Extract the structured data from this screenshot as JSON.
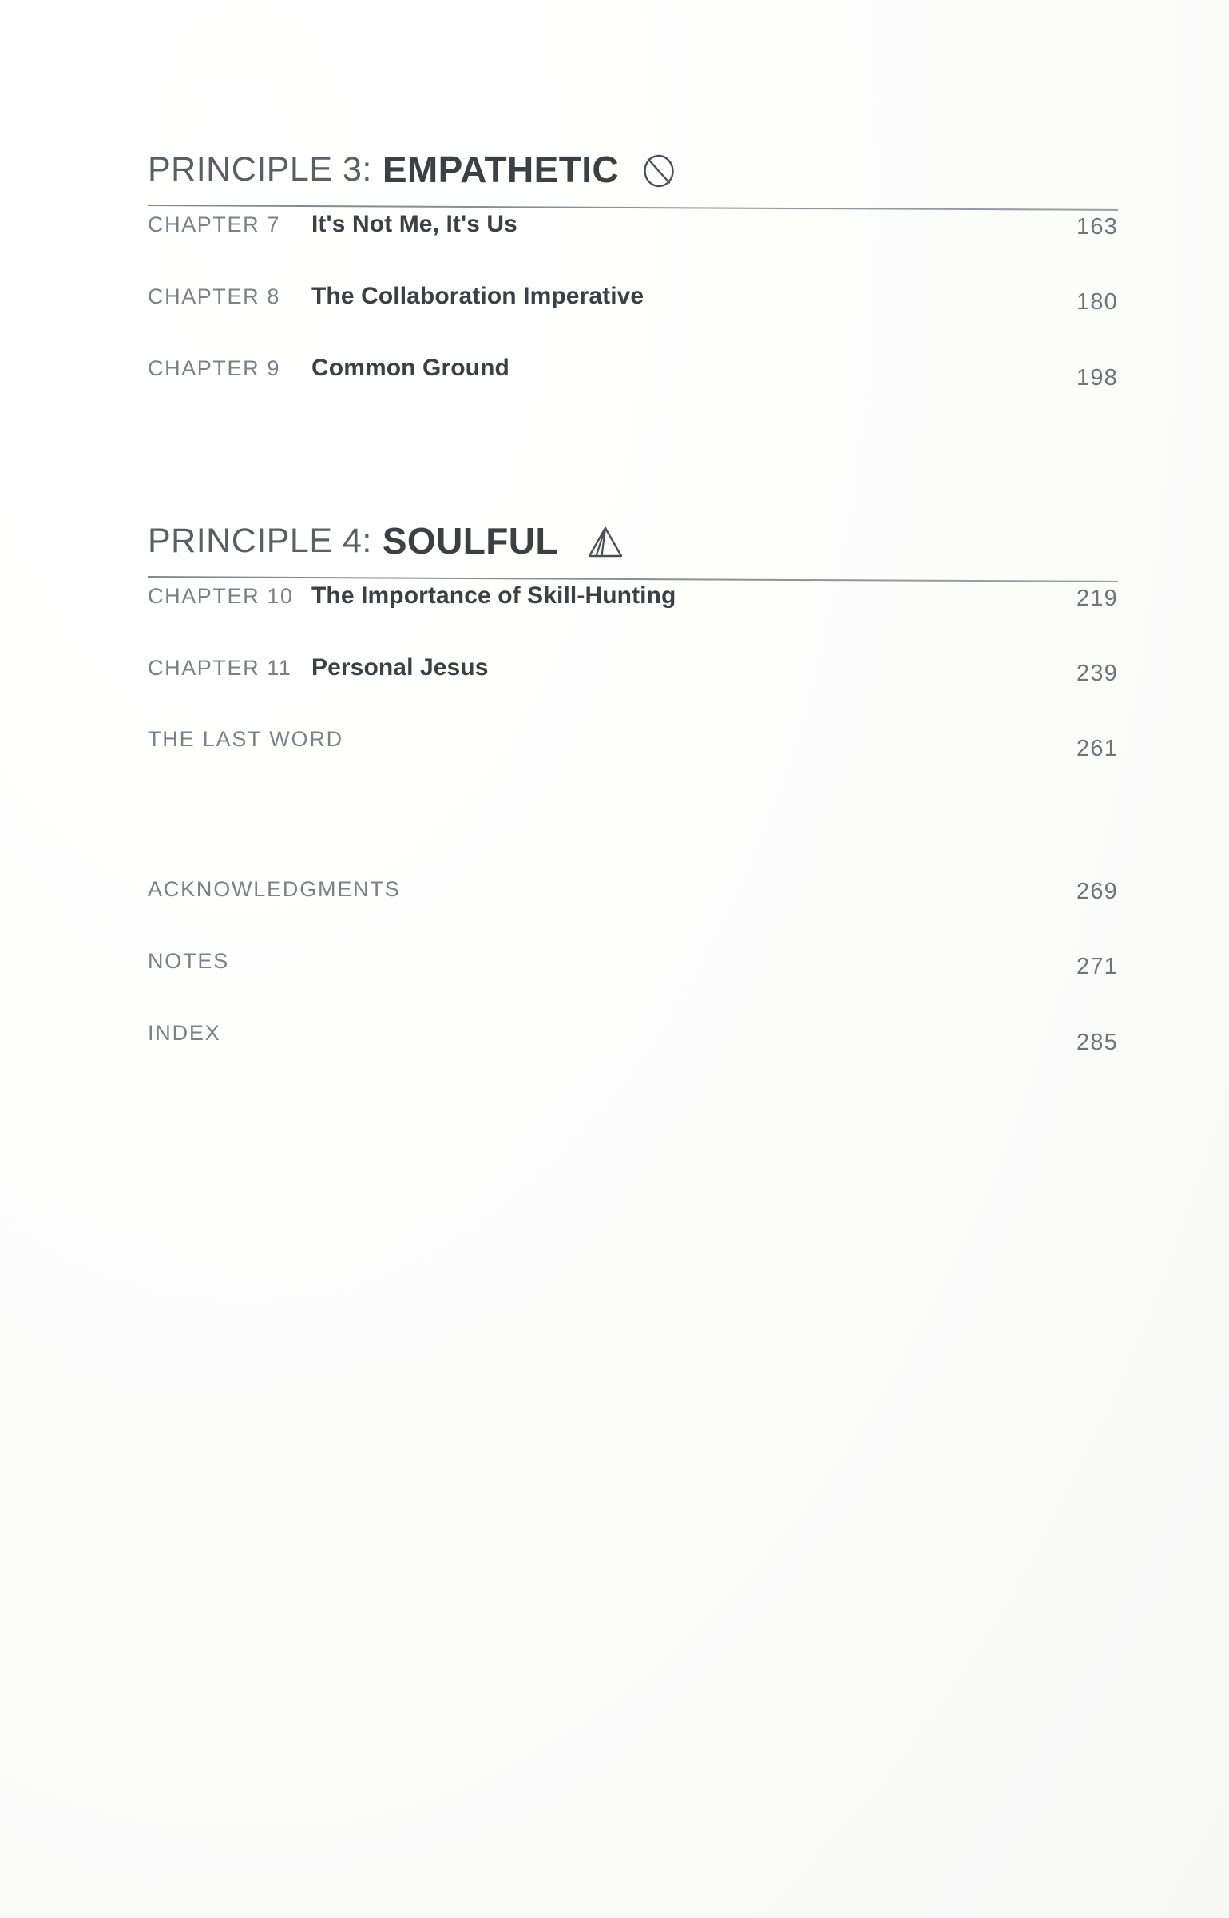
{
  "document": {
    "type": "book-table-of-contents"
  },
  "sections": [
    {
      "label": "PRINCIPLE 3:",
      "name": "EMPATHETIC",
      "icon": "circle-slash-icon",
      "entries": [
        {
          "label": "CHAPTER 7",
          "title": "It's Not Me, It's Us",
          "page": "163"
        },
        {
          "label": "CHAPTER 8",
          "title": "The Collaboration Imperative",
          "page": "180"
        },
        {
          "label": "CHAPTER 9",
          "title": "Common Ground",
          "page": "198"
        }
      ]
    },
    {
      "label": "PRINCIPLE 4:",
      "name": "SOULFUL",
      "icon": "triangle-mountain-icon",
      "entries": [
        {
          "label": "CHAPTER 10",
          "title": "The Importance of Skill-Hunting",
          "page": "219"
        },
        {
          "label": "CHAPTER 11",
          "title": "Personal Jesus",
          "page": "239"
        },
        {
          "label": "THE LAST WORD",
          "title": "",
          "page": "261"
        }
      ]
    }
  ],
  "back_matter": [
    {
      "label": "ACKNOWLEDGMENTS",
      "page": "269"
    },
    {
      "label": "NOTES",
      "page": "271"
    },
    {
      "label": "INDEX",
      "page": "285"
    }
  ],
  "colors": {
    "text_dark": "#3b4043",
    "text_muted": "#7c8185",
    "rule": "#7b7f83",
    "paper": "#fdfdfd"
  }
}
